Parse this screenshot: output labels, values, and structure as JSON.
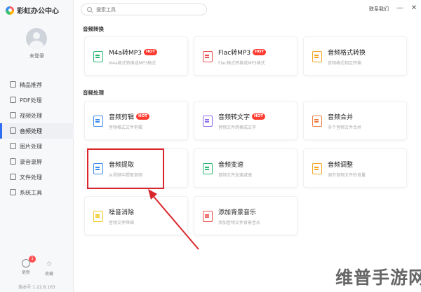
{
  "app": {
    "title": "彩虹办公中心",
    "login_status": "未登录",
    "version": "版本号:1.22.8.163"
  },
  "search": {
    "placeholder": "搜索工具"
  },
  "window": {
    "contact": "联系我们",
    "minimize": "—",
    "close": "✕"
  },
  "sidebar": {
    "items": [
      {
        "label": "精品推荐",
        "icon": "thumb-up-icon",
        "active": false
      },
      {
        "label": "PDF处理",
        "icon": "pdf-icon",
        "active": false
      },
      {
        "label": "视频处理",
        "icon": "video-icon",
        "active": false
      },
      {
        "label": "音频处理",
        "icon": "music-note-icon",
        "active": true
      },
      {
        "label": "图片处理",
        "icon": "image-icon",
        "active": false
      },
      {
        "label": "录音录屏",
        "icon": "record-icon",
        "active": false
      },
      {
        "label": "文件处理",
        "icon": "folder-icon",
        "active": false
      },
      {
        "label": "系统工具",
        "icon": "toolbox-icon",
        "active": false
      }
    ],
    "footer": {
      "update_label": "更新",
      "update_badge": "1",
      "favorite_label": "收藏"
    }
  },
  "sections": [
    {
      "title": "音频转换",
      "cards": [
        {
          "title": "M4a转MP3",
          "desc": "M4a格式转换成MP3格式",
          "hot": "HOT",
          "icon_color": "#2eb872"
        },
        {
          "title": "Flac转MP3",
          "desc": "Flac格式转换成MP3格式",
          "hot": "HOT",
          "icon_color": "#e9534f"
        },
        {
          "title": "音频格式转换",
          "desc": "音频格式相互转换",
          "hot": "",
          "icon_color": "#f5a623"
        }
      ]
    },
    {
      "title": "音频处理",
      "cards": [
        {
          "title": "音频剪辑",
          "desc": "音频格式文件剪辑",
          "hot": "HOT",
          "icon_color": "#3c8cf0"
        },
        {
          "title": "音频转文字",
          "desc": "音频文件转换成文字",
          "hot": "HOT",
          "icon_color": "#8e6cf0"
        },
        {
          "title": "音频合并",
          "desc": "多个音频文件合并",
          "hot": "",
          "icon_color": "#f07c3c"
        },
        {
          "title": "音频提取",
          "desc": "从视频中提取音频",
          "hot": "",
          "icon_color": "#3c8cf0"
        },
        {
          "title": "音频变速",
          "desc": "音频文件加速减速",
          "hot": "",
          "icon_color": "#2eb872"
        },
        {
          "title": "音频调整",
          "desc": "调节音频文件的音量",
          "hot": "",
          "icon_color": "#f5a623"
        },
        {
          "title": "噪音消除",
          "desc": "音频文件降噪",
          "hot": "",
          "icon_color": "#f5c623"
        },
        {
          "title": "添加背景音乐",
          "desc": "添加音频文件背景音乐",
          "hot": "",
          "icon_color": "#e9534f"
        }
      ]
    }
  ],
  "watermark": "维普手游网",
  "colors": {
    "accent": "#2f6df3",
    "highlight": "#d9262c",
    "hot": "#ff3b30"
  }
}
